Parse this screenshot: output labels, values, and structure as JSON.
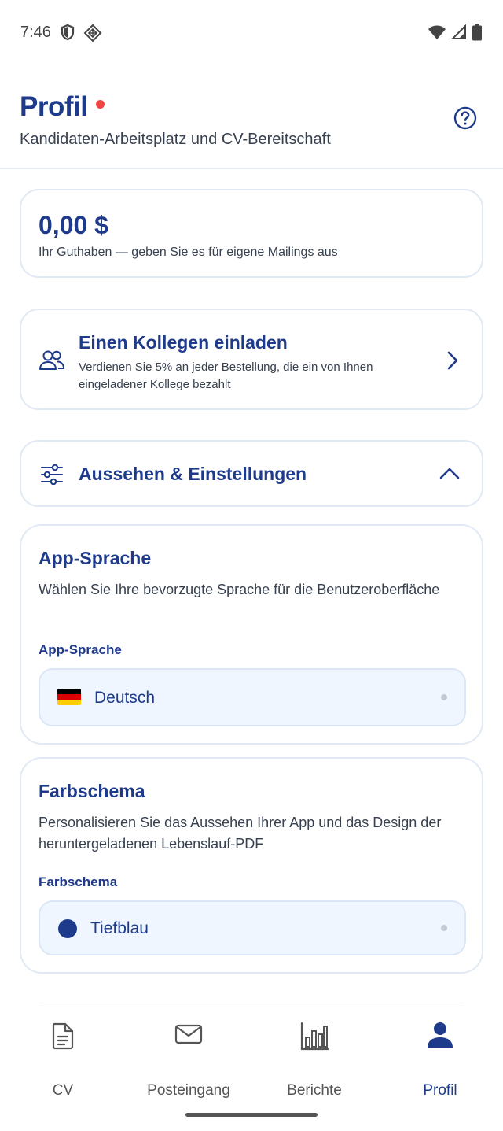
{
  "status_bar": {
    "time": "7:46"
  },
  "header": {
    "title": "Profil",
    "subtitle": "Kandidaten-Arbeitsplatz und CV-Bereitschaft"
  },
  "balance": {
    "amount": "0,00 $",
    "description": "Ihr Guthaben — geben Sie es für eigene Mailings aus"
  },
  "invite": {
    "title": "Einen Kollegen einladen",
    "description": "Verdienen Sie 5% an jeder Bestellung, die ein von Ihnen eingeladener Kollege bezahlt"
  },
  "settings": {
    "title": "Aussehen & Einstellungen"
  },
  "language_section": {
    "title": "App-Sprache",
    "description": "Wählen Sie Ihre bevorzugte Sprache für die Benutzeroberfläche",
    "field_label": "App-Sprache",
    "selected": "Deutsch"
  },
  "color_section": {
    "title": "Farbschema",
    "description": "Personalisieren Sie das Aussehen Ihrer App und das Design der heruntergeladenen Lebenslauf-PDF",
    "field_label": "Farbschema",
    "selected": "Tiefblau",
    "selected_color": "#1e3a8a"
  },
  "nav": {
    "items": [
      {
        "label": "CV",
        "icon": "document-icon"
      },
      {
        "label": "Posteingang",
        "icon": "mail-icon"
      },
      {
        "label": "Berichte",
        "icon": "bar-chart-icon"
      },
      {
        "label": "Profil",
        "icon": "user-icon",
        "active": true
      }
    ]
  },
  "colors": {
    "accent": "#1e3a8a",
    "notification_dot": "#ef4444"
  }
}
